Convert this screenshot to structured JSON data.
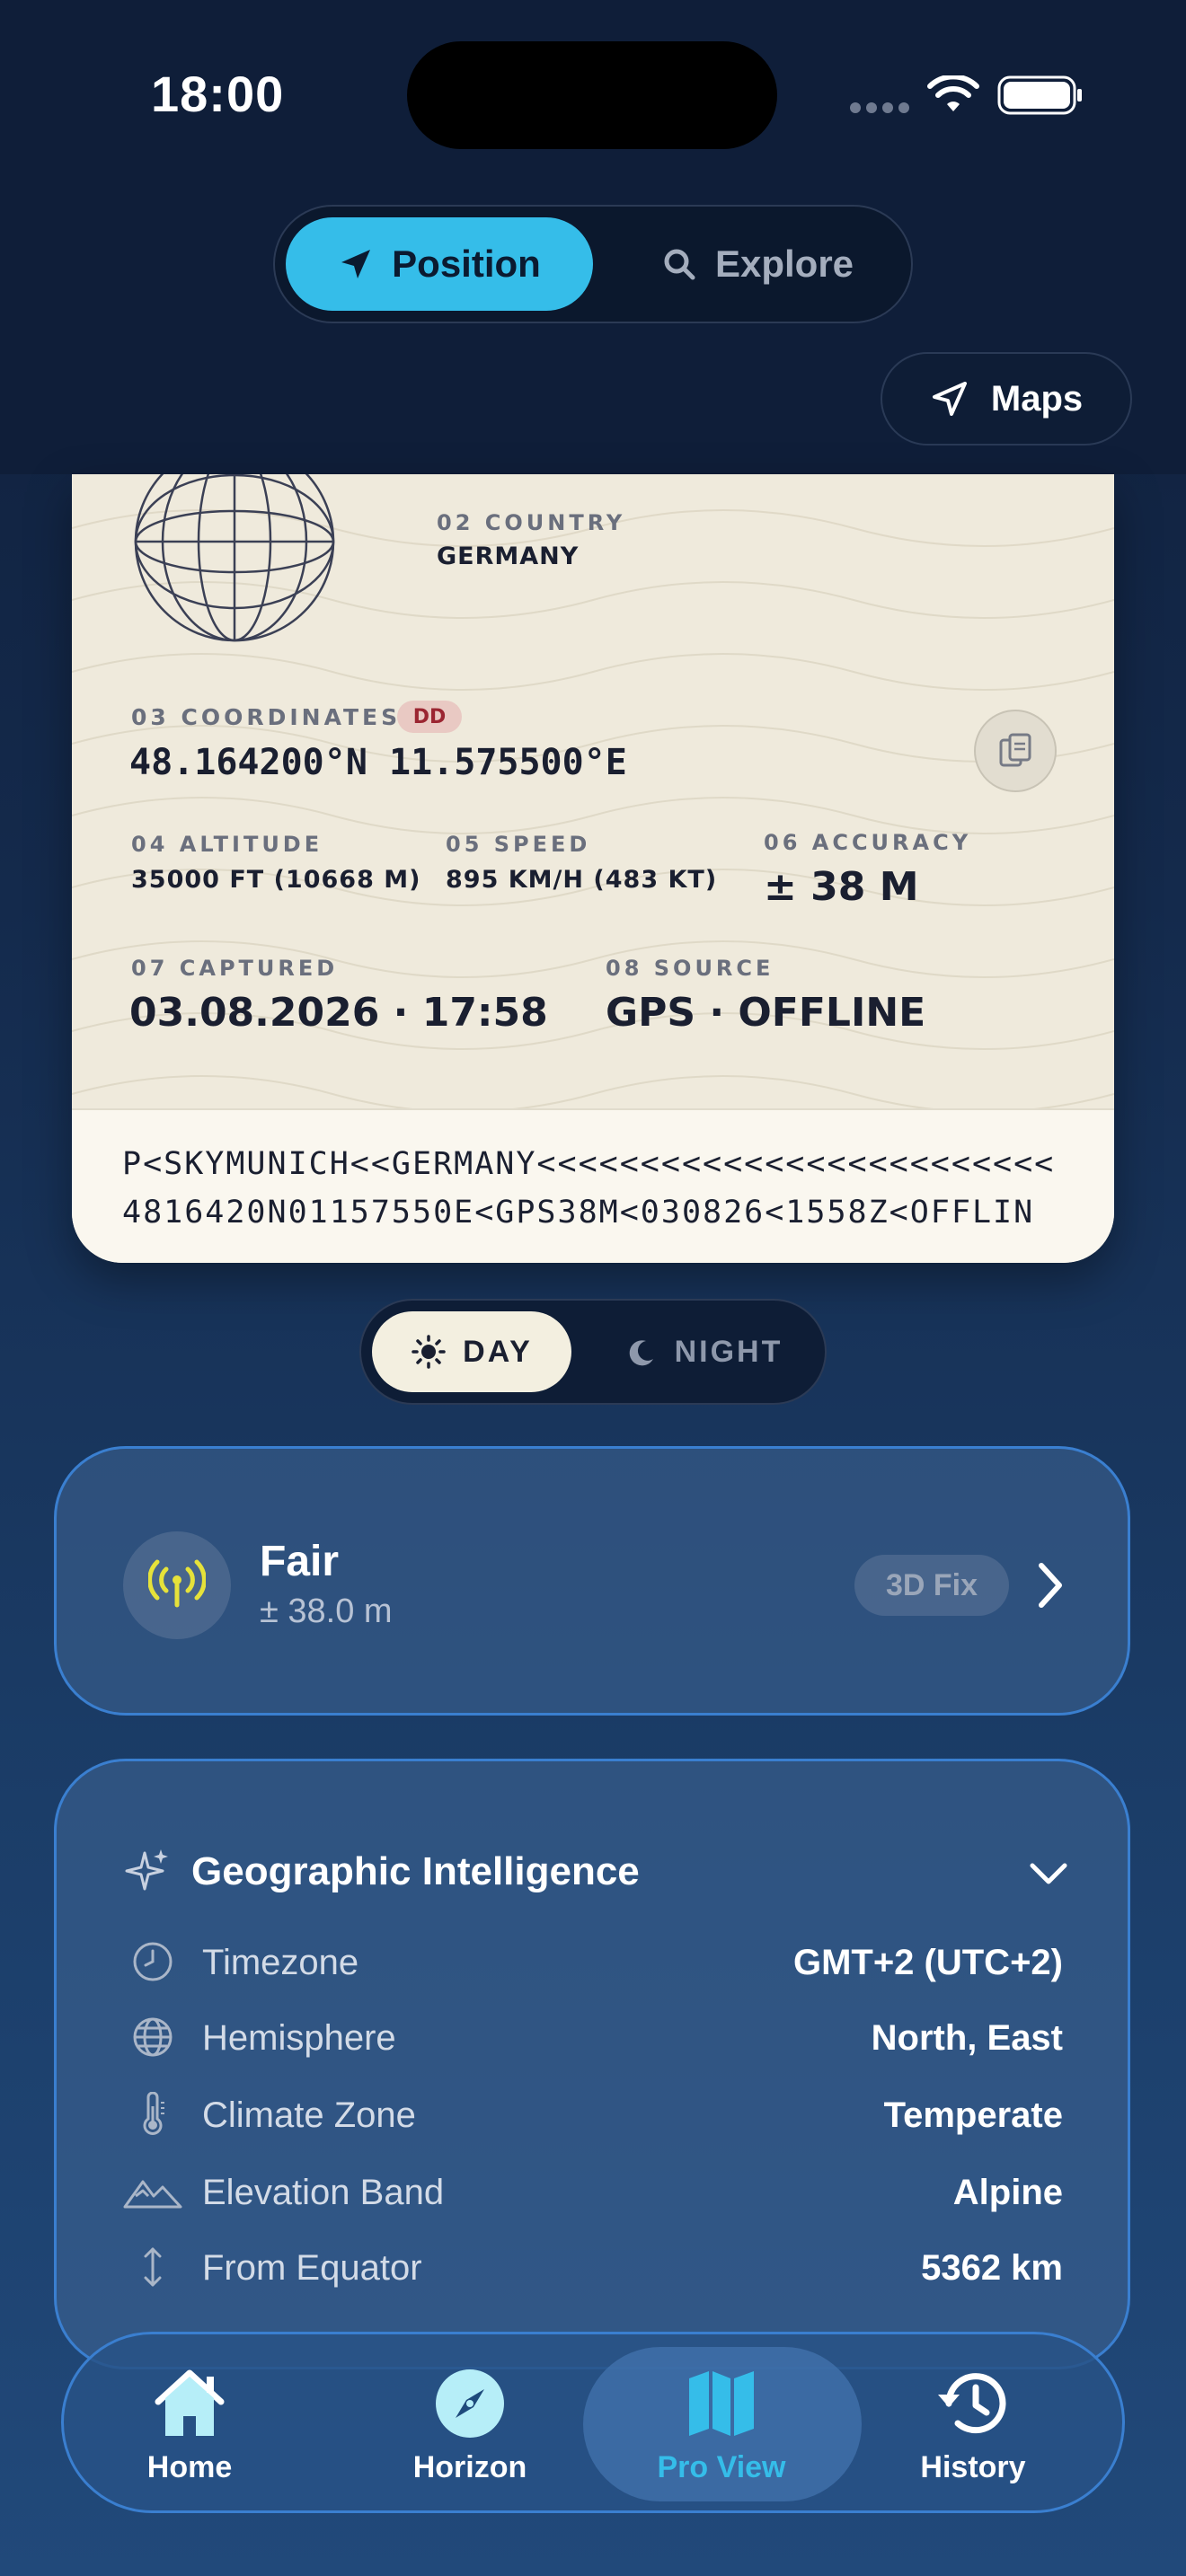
{
  "status": {
    "time": "18:00"
  },
  "top_segment": {
    "position_label": "Position",
    "explore_label": "Explore"
  },
  "maps_button": {
    "label": "Maps"
  },
  "passport": {
    "country_label": "02 COUNTRY",
    "country_value": "GERMANY",
    "coords_label": "03 COORDINATES",
    "coords_badge": "DD",
    "coords_value": "48.164200°N 11.575500°E",
    "altitude_label": "04 ALTITUDE",
    "altitude_value": "35000 FT (10668 M)",
    "speed_label": "05 SPEED",
    "speed_value": "895 KM/H (483 KT)",
    "accuracy_label": "06 ACCURACY",
    "accuracy_value": "± 38 M",
    "captured_label": "07 CAPTURED",
    "captured_value": "03.08.2026 · 17:58",
    "source_label": "08 SOURCE",
    "source_value": "GPS · OFFLINE",
    "mrz_line1": "P<SKYMUNICH<<GERMANY<<<<<<<<<<<<<<<<<<<<<<<<<",
    "mrz_line2": "4816420N01157550E<GPS38M<030826<1558Z<OFFLIN"
  },
  "theme_segment": {
    "day_label": "DAY",
    "night_label": "NIGHT"
  },
  "fix_card": {
    "title": "Fair",
    "subtitle": "± 38.0 m",
    "badge": "3D Fix",
    "icon_color": "#e6e23a"
  },
  "intelligence": {
    "title": "Geographic Intelligence",
    "rows": [
      {
        "icon": "clock-icon",
        "label": "Timezone",
        "value": "GMT+2 (UTC+2)"
      },
      {
        "icon": "globe-icon",
        "label": "Hemisphere",
        "value": "North, East"
      },
      {
        "icon": "thermometer-icon",
        "label": "Climate Zone",
        "value": "Temperate"
      },
      {
        "icon": "mountain-icon",
        "label": "Elevation Band",
        "value": "Alpine"
      },
      {
        "icon": "arrows-vertical-icon",
        "label": "From Equator",
        "value": "5362 km"
      }
    ]
  },
  "tabbar": {
    "tabs": [
      {
        "label": "Home",
        "icon": "house-icon"
      },
      {
        "label": "Horizon",
        "icon": "compass-icon"
      },
      {
        "label": "Pro View",
        "icon": "map-icon"
      },
      {
        "label": "History",
        "icon": "history-icon"
      }
    ],
    "active_color": "#35bde9"
  }
}
